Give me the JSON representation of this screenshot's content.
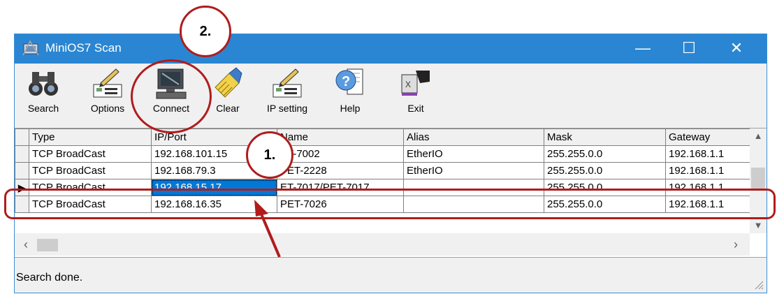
{
  "window": {
    "title": "MiniOS7 Scan",
    "controls": {
      "minimize": "—",
      "maximize": "☐",
      "close": "✕"
    }
  },
  "toolbar": {
    "buttons": [
      {
        "label": "Search",
        "icon": "binoculars-icon"
      },
      {
        "label": "Options",
        "icon": "options-pencil-icon"
      },
      {
        "label": "Connect",
        "icon": "computer-connect-icon"
      },
      {
        "label": "Clear",
        "icon": "broom-clear-icon"
      },
      {
        "label": "IP setting",
        "icon": "ip-setting-pencil-icon"
      },
      {
        "label": "Help",
        "icon": "help-question-icon"
      },
      {
        "label": "Exit",
        "icon": "exit-door-icon"
      }
    ]
  },
  "grid": {
    "columns": [
      "Type",
      "IP/Port",
      "Name",
      "Alias",
      "Mask",
      "Gateway"
    ],
    "rows": [
      [
        "TCP BroadCast",
        "192.168.101.15",
        "ET-7002",
        "EtherIO",
        "255.255.0.0",
        "192.168.1.1"
      ],
      [
        "TCP BroadCast",
        "192.168.79.3",
        "PET-2228",
        "EtherIO",
        "255.255.0.0",
        "192.168.1.1"
      ],
      [
        "TCP BroadCast",
        "192.168.15.17",
        "ET-7017/PET-7017",
        "",
        "255.255.0.0",
        "192.168.1.1"
      ],
      [
        "TCP BroadCast",
        "192.168.16.35",
        "PET-7026",
        "",
        "255.255.0.0",
        "192.168.1.1"
      ]
    ],
    "selected_row": 2,
    "row_indicator": "▶"
  },
  "status": {
    "text": "Search done."
  },
  "callouts": {
    "step1": "1.",
    "step2": "2."
  },
  "colors": {
    "titlebar": "#2a86d2",
    "selection": "#0078d7",
    "callout_red": "#b01c1c"
  }
}
